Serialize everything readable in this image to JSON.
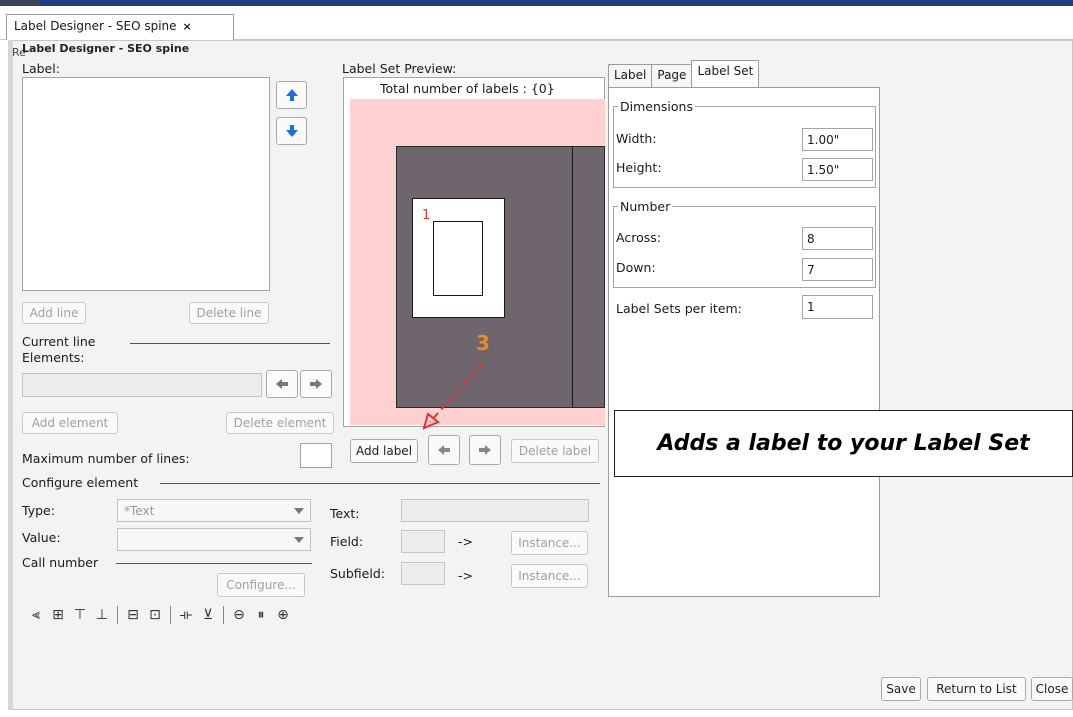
{
  "window": {
    "tab_title": "Label Designer - SEO spine",
    "tab_close": "×",
    "panel_title": "Label Designer - SEO spine",
    "panel_overlap_text": "Re"
  },
  "label_section": {
    "label": "Label:",
    "add_line": "Add line",
    "delete_line": "Delete line",
    "current_line_elements": [
      "Current line",
      "Elements:"
    ],
    "add_element": "Add element",
    "delete_element": "Delete element",
    "max_lines_label": "Maximum number of lines:",
    "max_lines_value": ""
  },
  "configure": {
    "heading": "Configure element",
    "type_label": "Type:",
    "type_value": "*Text",
    "value_label": "Value:",
    "value_value": "",
    "call_number_label": "Call number",
    "configure_button": "Configure...",
    "text_label": "Text:",
    "field_label": "Field:",
    "subfield_label": "Subfield:",
    "arrow_text": "->",
    "instance_button": "Instance..."
  },
  "preview": {
    "label": "Label Set Preview:",
    "total": "Total number of labels : {0}",
    "label_number": "1",
    "annotation_number": "3",
    "add_label": "Add label",
    "delete_label": "Delete label",
    "colors": {
      "background": "#ffd0d0",
      "sheet": "#6e666c",
      "accent": "#e0322c",
      "orange": "#e48a2a"
    }
  },
  "right_tabs": {
    "tabs": [
      "Label",
      "Page",
      "Label Set"
    ],
    "active_tab": "Label Set",
    "dimensions": {
      "legend": "Dimensions",
      "width_label": "Width:",
      "width_value": "1.00\"",
      "height_label": "Height:",
      "height_value": "1.50\""
    },
    "number": {
      "legend": "Number",
      "across_label": "Across:",
      "across_value": "8",
      "down_label": "Down:",
      "down_value": "7"
    },
    "sets_per_item_label": "Label Sets per item:",
    "sets_per_item_value": "1"
  },
  "callout": "Adds a label to your Label Set",
  "footer": {
    "save": "Save",
    "return": "Return to List",
    "close": "Close"
  }
}
